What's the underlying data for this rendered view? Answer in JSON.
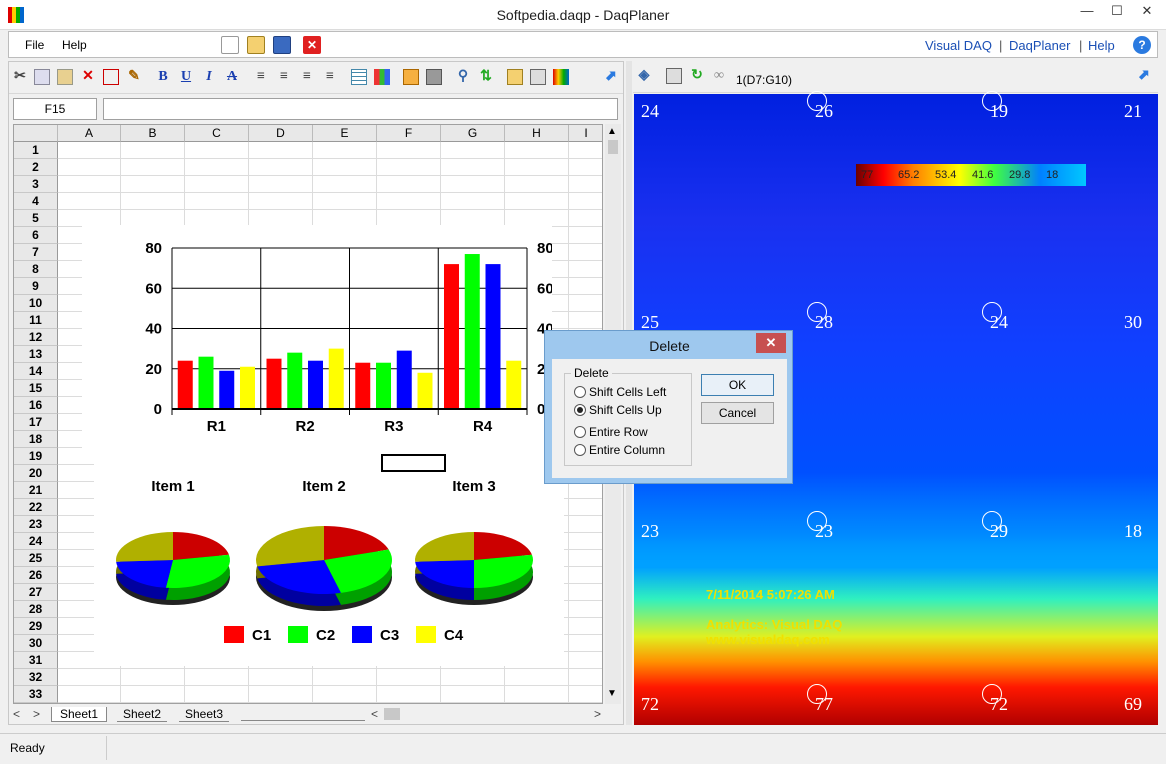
{
  "window": {
    "title": "Softpedia.daqp - DaqPlaner",
    "min": "—",
    "max": "☐",
    "close": "✕"
  },
  "menu": {
    "file": "File",
    "help": "Help"
  },
  "toplinks": {
    "visual_daq": "Visual DAQ",
    "sep1": "|",
    "daqplaner": "DaqPlaner",
    "sep2": "|",
    "help": "Help"
  },
  "sheet": {
    "cell_ref": "F15",
    "formula": "",
    "columns": [
      "A",
      "B",
      "C",
      "D",
      "E",
      "F",
      "G",
      "H",
      "I"
    ],
    "rows": [
      "1",
      "2",
      "3",
      "4",
      "5",
      "6",
      "7",
      "8",
      "9",
      "10",
      "11",
      "12",
      "13",
      "14",
      "15",
      "16",
      "17",
      "18",
      "19",
      "20",
      "21",
      "22",
      "23",
      "24",
      "25",
      "26",
      "27",
      "28",
      "29",
      "30",
      "31",
      "32",
      "33"
    ],
    "tabs": [
      "Sheet1",
      "Sheet2",
      "Sheet3"
    ]
  },
  "chart_data": [
    {
      "type": "bar",
      "categories": [
        "R1",
        "R2",
        "R3",
        "R4"
      ],
      "series": [
        {
          "name": "C1",
          "color": "#ff0000",
          "values": [
            24,
            25,
            23,
            72
          ]
        },
        {
          "name": "C2",
          "color": "#00ff00",
          "values": [
            26,
            28,
            23,
            77
          ]
        },
        {
          "name": "C3",
          "color": "#0000ff",
          "values": [
            19,
            24,
            29,
            72
          ]
        },
        {
          "name": "C4",
          "color": "#ffff00",
          "values": [
            21,
            30,
            18,
            24
          ]
        }
      ],
      "ylim": [
        0,
        80
      ],
      "yticks": [
        "0",
        "20",
        "40",
        "60",
        "80"
      ]
    },
    {
      "type": "pie",
      "titles": [
        "Item 1",
        "Item 2",
        "Item 3"
      ],
      "legend": [
        "C1",
        "C2",
        "C3",
        "C4"
      ],
      "colors": [
        "#cc0000",
        "#00ff00",
        "#0000ff",
        "#b0b000"
      ]
    }
  ],
  "heatmap": {
    "range_label": "1(D7:G10)",
    "legend_values": [
      "77",
      "65.2",
      "53.4",
      "41.6",
      "29.8",
      "18"
    ],
    "row1": [
      "24",
      "26",
      "19",
      "21"
    ],
    "row2": [
      "25",
      "28",
      "24",
      "30"
    ],
    "row3": [
      "23",
      "23",
      "29",
      "18"
    ],
    "row4": [
      "72",
      "77",
      "72",
      "69"
    ],
    "timestamp": "7/11/2014 5:07:26 AM",
    "analytics": "Analytics: Visual DAQ",
    "website": "www.visualdaq.com"
  },
  "dialog": {
    "title": "Delete",
    "group": "Delete",
    "options": [
      "Shift Cells Left",
      "Shift Cells Up",
      "Entire Row",
      "Entire Column"
    ],
    "selected": 1,
    "ok": "OK",
    "cancel": "Cancel"
  },
  "status": {
    "text": "Ready"
  }
}
